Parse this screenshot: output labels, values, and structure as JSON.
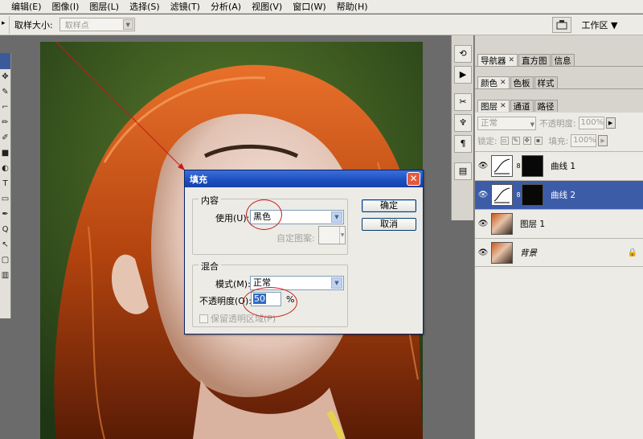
{
  "menu": [
    "编辑(E)",
    "图像(I)",
    "图层(L)",
    "选择(S)",
    "滤镜(T)",
    "分析(A)",
    "视图(V)",
    "窗口(W)",
    "帮助(H)"
  ],
  "options_bar": {
    "tool_stub": "▸",
    "sample_size_label": "取样大小:",
    "sample_size_value": "取样点",
    "workspace_icon": "workspace-icon",
    "workspace_label": "工作区 ▼"
  },
  "toolbox_glyphs": [
    "✥",
    "✎",
    "⌐",
    "✏",
    "✐",
    "■",
    "◐",
    "T",
    "▭",
    "✒",
    "Q",
    "↖",
    "▢",
    "▥"
  ],
  "dock": {
    "icons": [
      "history-icon",
      "actions-icon",
      "tools-icon",
      "brush-icon",
      "paragraph-icon",
      "layer-comps-icon"
    ],
    "glyphs": [
      "⟲",
      "▶",
      "✂",
      "♆",
      "¶",
      "▤"
    ]
  },
  "panels": {
    "row1_tabs": [
      "导航器",
      "直方图",
      "信息"
    ],
    "row2_tabs": [
      "颜色",
      "色板",
      "样式"
    ],
    "row3_tabs": [
      "图层",
      "通道",
      "路径"
    ],
    "close_glyph": "✕",
    "blend_mode": "正常",
    "opacity_label": "不透明度:",
    "opacity_value": "100%",
    "lock_label": "锁定:",
    "fill_label": "填充:",
    "fill_value": "100%",
    "eye_glyph": "👁",
    "link_glyph": "8",
    "lock_glyph": "🔒",
    "layers": [
      {
        "name": "曲线 1",
        "selected": false
      },
      {
        "name": "曲线 2",
        "selected": true
      },
      {
        "name": "图层 1",
        "selected": false
      },
      {
        "name": "背景",
        "selected": false,
        "locked": true
      }
    ]
  },
  "dialog": {
    "title": "填充",
    "close_glyph": "✕",
    "content_group": "内容",
    "use_label": "使用(U):",
    "use_value": "黑色",
    "custom_pattern_label": "自定图案:",
    "blend_group": "混合",
    "mode_label": "模式(M):",
    "mode_value": "正常",
    "opacity_label": "不透明度(O):",
    "opacity_value": "50",
    "percent": "%",
    "preserve_label": "保留透明区域(P)",
    "ok": "确定",
    "cancel": "取消"
  },
  "colors": {
    "annotation_red": "#c31a1a",
    "selection_blue": "#3c5ca8",
    "title_blue": "#1c4dbf"
  }
}
